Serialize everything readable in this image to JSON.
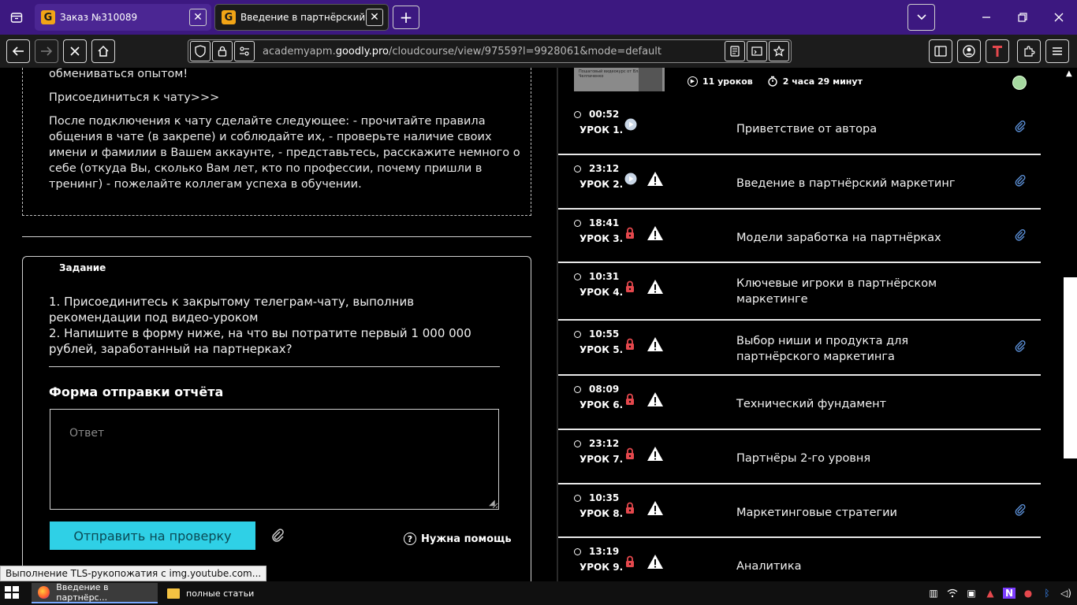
{
  "browser": {
    "tabs": [
      {
        "title": "Заказ №310089",
        "favicon": "G"
      },
      {
        "title": "Введение в партнёрский мар",
        "favicon": "G"
      }
    ],
    "new_tab": "+",
    "url_host_pre": "academyapm.",
    "url_host": "goodly.pro",
    "url_path": "/cloudcourse/view/97559?l=9928061&mode=default"
  },
  "left": {
    "intro_tail": "обмениваться опытом!",
    "join_chat": "Присоединиться к чату>>>",
    "instructions": "После подключения к чату сделайте следующее: - прочитайте правила общения в чате (в закрепе) и соблюдайте их, - проверьте наличие своих имени и фамилии в Вашем аккаунте, - представьтесь, расскажите немного о себе (откуда Вы, сколько Вам лет, кто по профессии, почему пришли в тренинг) - пожелайте коллегам успеха в обучении.",
    "task_label": "Задание",
    "task_line1": "1. Присоединитесь к закрытому телеграм-чату, выполнив рекомендации под видео-уроком",
    "task_line2": "2. Напишите в форму ниже, на что вы потратите первый 1 000 000 рублей, заработанный на партнерках?",
    "form_title": "Форма отправки отчёта",
    "answer_placeholder": "Ответ",
    "submit_label": "Отправить на проверку",
    "help_label": "Нужна помощь"
  },
  "course": {
    "thumb_text": "Пошаговый видеокурс от Владислава Челпаченко",
    "lessons_count": "11 уроков",
    "total_time": "2 часа 29 минут"
  },
  "lessons": [
    {
      "time": "00:52",
      "num": "УРОК 1.",
      "title": "Приветствие от автора",
      "status": "play",
      "warn": false,
      "clip": true
    },
    {
      "time": "23:12",
      "num": "УРОК 2.",
      "title": "Введение в партнёрский маркетинг",
      "status": "play",
      "warn": true,
      "clip": true
    },
    {
      "time": "18:41",
      "num": "УРОК 3.",
      "title": "Модели заработка на партнёрках",
      "status": "lock",
      "warn": true,
      "clip": true
    },
    {
      "time": "10:31",
      "num": "УРОК 4.",
      "title": "Ключевые игроки в партнёрском маркетинге",
      "status": "lock",
      "warn": true,
      "clip": false
    },
    {
      "time": "10:55",
      "num": "УРОК 5.",
      "title": "Выбор ниши и продукта для партнёрского маркетинга",
      "status": "lock",
      "warn": true,
      "clip": true
    },
    {
      "time": "08:09",
      "num": "УРОК 6.",
      "title": "Технический фундамент",
      "status": "lock",
      "warn": true,
      "clip": false
    },
    {
      "time": "23:12",
      "num": "УРОК 7.",
      "title": "Партнёры 2-го уровня",
      "status": "lock",
      "warn": true,
      "clip": false
    },
    {
      "time": "10:35",
      "num": "УРОК 8.",
      "title": "Маркетинговые стратегии",
      "status": "lock",
      "warn": true,
      "clip": true
    },
    {
      "time": "13:19",
      "num": "УРОК 9.",
      "title": "Аналитика",
      "status": "lock",
      "warn": true,
      "clip": false
    }
  ],
  "status_text": "Выполнение TLS-рукопожатия с img.youtube.com...",
  "taskbar": {
    "app1": "Введение в партнёрс...",
    "app2": "полные статьи"
  },
  "colors": {
    "tab_bar": "#3c1880",
    "accent_button": "#2fd0e6",
    "lock_red": "#e5484d",
    "done_green": "#a6d9a0"
  }
}
